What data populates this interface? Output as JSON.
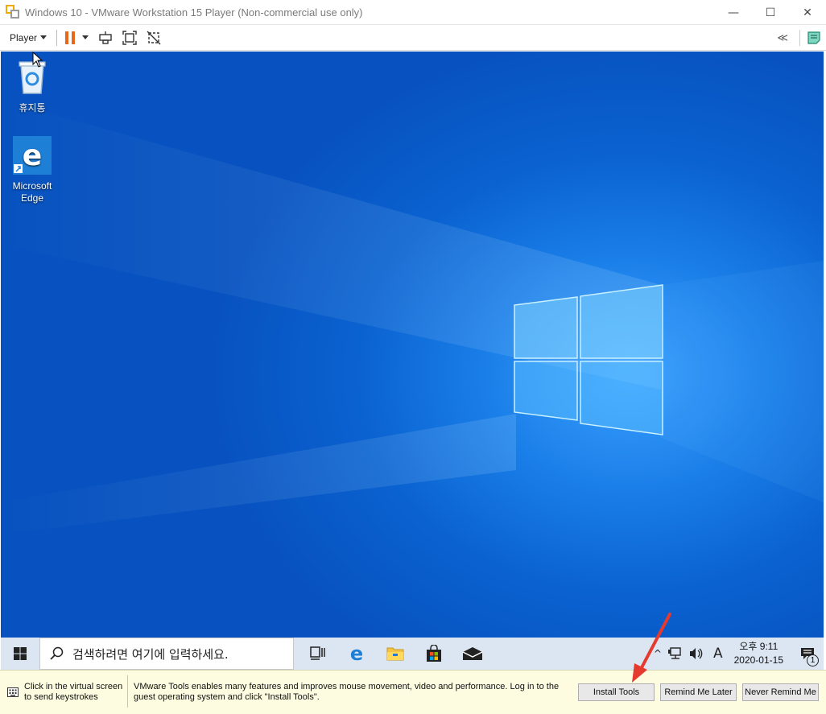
{
  "window": {
    "title": "Windows 10 - VMware Workstation 15 Player (Non-commercial use only)",
    "minimize": "—",
    "maximize": "☐",
    "close": "✕"
  },
  "toolbar": {
    "player_label": "Player",
    "icons": [
      "pause-icon",
      "send-ctrl-alt-del-icon",
      "fullscreen-icon",
      "unity-icon"
    ],
    "collapse": "≪"
  },
  "desktop": {
    "icons": [
      {
        "label": "휴지통",
        "icon": "recycle-bin-icon"
      },
      {
        "label": "Microsoft Edge",
        "icon": "edge-icon"
      }
    ]
  },
  "taskbar": {
    "search_placeholder": "검색하려면 여기에 입력하세요.",
    "apps": [
      "task-view-icon",
      "edge-icon",
      "file-explorer-icon",
      "store-icon",
      "mail-icon"
    ],
    "ime": "A",
    "clock": {
      "time": "오후 9:11",
      "date": "2020-01-15"
    },
    "notifications": "1"
  },
  "infobar": {
    "keyboard_hint": "Click in the virtual screen to send keystrokes",
    "message": "VMware Tools enables many features and improves mouse movement, video and performance. Log in to the guest operating system and click \"Install Tools\".",
    "install_label": "Install Tools",
    "remind_label": "Remind Me Later",
    "never_label": "Never Remind Me"
  },
  "colors": {
    "desktop_blue": "#0a62d0",
    "pause_orange": "#e8671c",
    "infobar_bg": "#fdfce0",
    "arrow_red": "#e53a2e"
  }
}
